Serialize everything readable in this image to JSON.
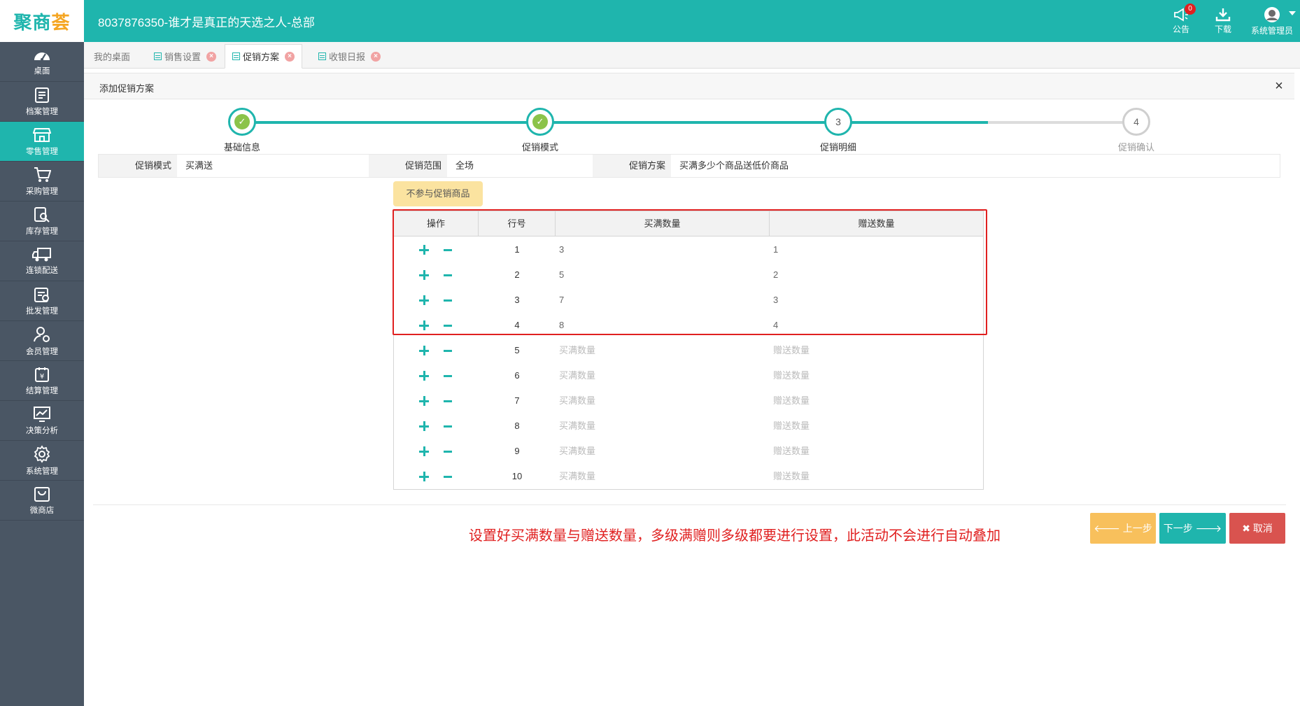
{
  "app": {
    "logo_main": "聚商",
    "logo_accent": "荟",
    "store_title": "8037876350-谁才是真正的天选之人-总部"
  },
  "top_actions": {
    "notice_label": "公告",
    "notice_badge": "0",
    "download_label": "下载",
    "user_label": "系统管理员"
  },
  "sidebar": {
    "items": [
      {
        "label": "桌面",
        "icon": "dashboard-icon"
      },
      {
        "label": "档案管理",
        "icon": "archive-icon"
      },
      {
        "label": "零售管理",
        "icon": "store-icon",
        "active": true
      },
      {
        "label": "采购管理",
        "icon": "cart-icon"
      },
      {
        "label": "库存管理",
        "icon": "inventory-icon"
      },
      {
        "label": "连锁配送",
        "icon": "truck-icon"
      },
      {
        "label": "批发管理",
        "icon": "wholesale-icon"
      },
      {
        "label": "会员管理",
        "icon": "member-icon"
      },
      {
        "label": "结算管理",
        "icon": "settlement-icon"
      },
      {
        "label": "决策分析",
        "icon": "chart-icon"
      },
      {
        "label": "系统管理",
        "icon": "gear-icon"
      },
      {
        "label": "微商店",
        "icon": "shop-bag-icon"
      }
    ]
  },
  "tabs": [
    {
      "label": "我的桌面"
    },
    {
      "label": "销售设置"
    },
    {
      "label": "促销方案",
      "active": true
    },
    {
      "label": "收银日报"
    }
  ],
  "panel": {
    "title": "添加促销方案",
    "close": "×"
  },
  "steps": [
    {
      "label": "基础信息",
      "state": "done",
      "number": "1"
    },
    {
      "label": "促销模式",
      "state": "done",
      "number": "2"
    },
    {
      "label": "促销明细",
      "state": "current",
      "number": "3"
    },
    {
      "label": "促销确认",
      "state": "todo",
      "number": "4"
    }
  ],
  "info": {
    "mode_label": "促销模式",
    "mode_value": "买满送",
    "scope_label": "促销范围",
    "scope_value": "全场",
    "plan_label": "促销方案",
    "plan_value": "买满多少个商品送低价商品"
  },
  "exclude_button": "不参与促销商品",
  "table": {
    "headers": [
      "操作",
      "行号",
      "买满数量",
      "赠送数量"
    ],
    "placeholder_buy": "买满数量",
    "placeholder_gift": "赠送数量",
    "rows": [
      {
        "no": "1",
        "buy": "3",
        "gift": "1"
      },
      {
        "no": "2",
        "buy": "5",
        "gift": "2"
      },
      {
        "no": "3",
        "buy": "7",
        "gift": "3"
      },
      {
        "no": "4",
        "buy": "8",
        "gift": "4"
      },
      {
        "no": "5",
        "buy": "",
        "gift": ""
      },
      {
        "no": "6",
        "buy": "",
        "gift": ""
      },
      {
        "no": "7",
        "buy": "",
        "gift": ""
      },
      {
        "no": "8",
        "buy": "",
        "gift": ""
      },
      {
        "no": "9",
        "buy": "",
        "gift": ""
      },
      {
        "no": "10",
        "buy": "",
        "gift": ""
      }
    ]
  },
  "annotation": "设置好买满数量与赠送数量，多级满赠则多级都要进行设置，此活动不会进行自动叠加",
  "buttons": {
    "prev": "上一步",
    "next": "下一步",
    "cancel": "取消"
  },
  "colors": {
    "primary": "#1fb5ad",
    "sidebar": "#4a5664",
    "warning": "#f8c05c",
    "danger": "#d9534f",
    "highlight": "#e02020"
  }
}
